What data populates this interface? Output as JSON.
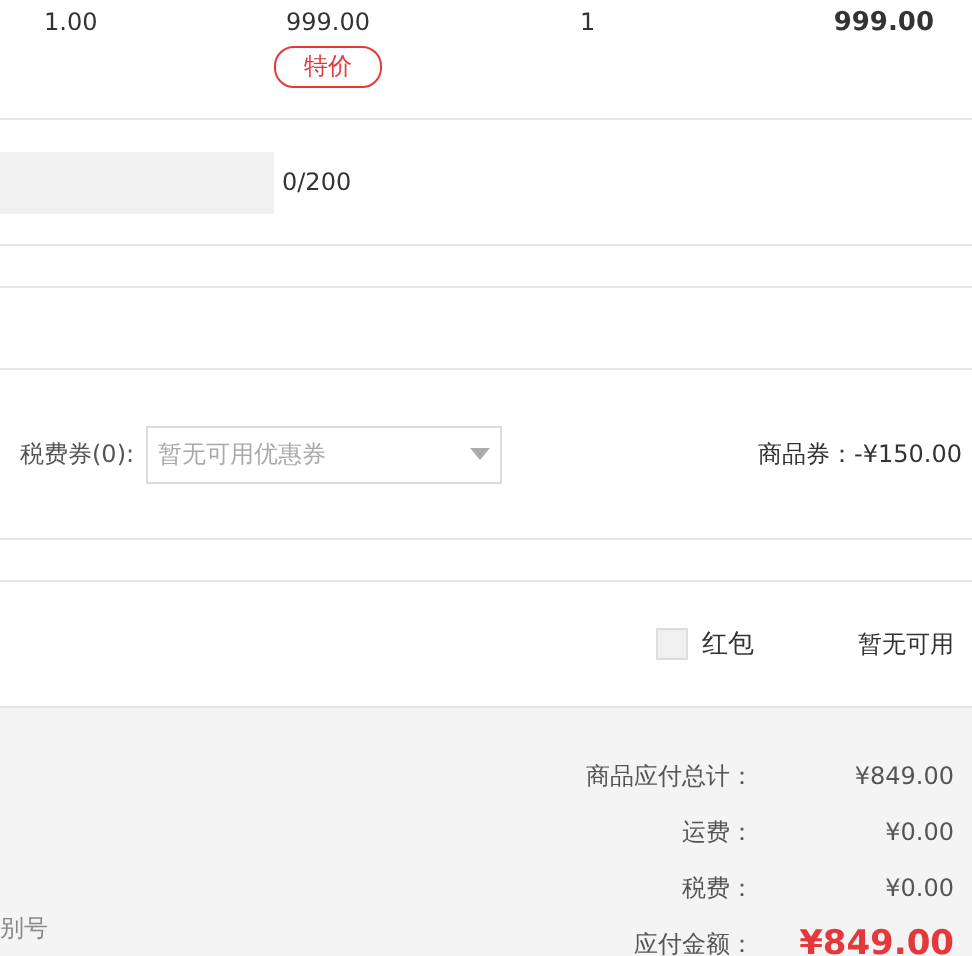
{
  "item": {
    "unit_price": "1.00",
    "price": "999.00",
    "tag": "特价",
    "quantity": "1",
    "subtotal": "999.00"
  },
  "remark": {
    "counter": "0/200"
  },
  "coupons": {
    "tax_label": "税费券(0):",
    "tax_select": {
      "placeholder": "暂无可用优惠券",
      "disabled": true
    },
    "goods_coupon": "商品券：-¥150.00"
  },
  "red_packet": {
    "label": "红包",
    "checked": false,
    "status": "暂无可用"
  },
  "invoice_hint": "别号",
  "summary": [
    {
      "label": "商品应付总计：",
      "value": "¥849.00",
      "kind": "normal"
    },
    {
      "label": "运费：",
      "value": "¥0.00",
      "kind": "normal"
    },
    {
      "label": "税费：",
      "value": "¥0.00",
      "kind": "normal"
    },
    {
      "label": "应付金额：",
      "value": "¥849.00",
      "kind": "total"
    }
  ]
}
